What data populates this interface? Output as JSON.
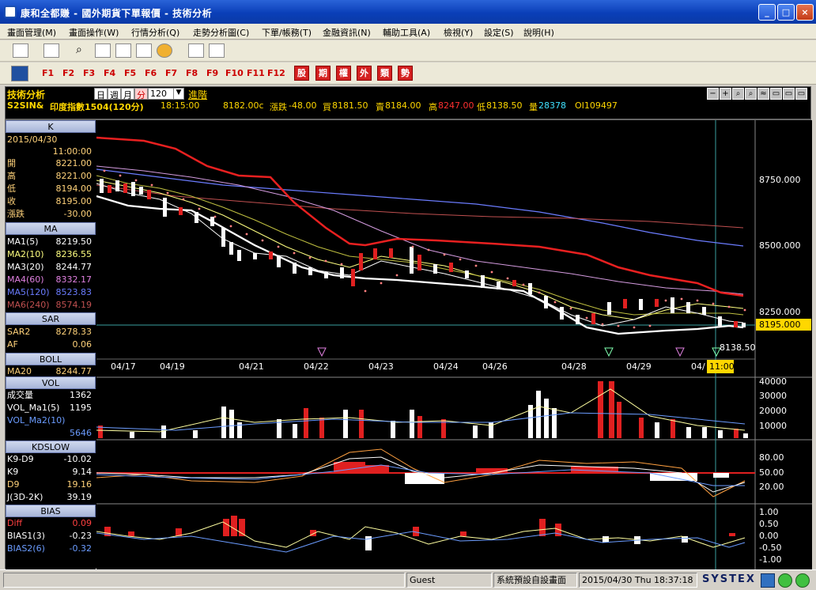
{
  "window": {
    "title": "康和全都賺 - 國外期貨下單報價 - 技術分析",
    "controls": [
      "_",
      "□",
      "×"
    ]
  },
  "menu": [
    "畫面管理(M)",
    "畫面操作(W)",
    "行情分析(Q)",
    "走勢分析圖(C)",
    "下單/帳務(T)",
    "金融資訊(N)",
    "輔助工具(A)",
    "檢視(Y)",
    "設定(S)",
    "說明(H)"
  ],
  "toolbar": {
    "fkeys": [
      "F1",
      "F2",
      "F3",
      "F4",
      "F5",
      "F6",
      "F7",
      "F8",
      "F9",
      "F10",
      "F11",
      "F12"
    ],
    "quick_buttons": [
      "股",
      "期",
      "權",
      "外",
      "類",
      "勢"
    ]
  },
  "chart_header": {
    "title": "技術分析",
    "periods": [
      "日",
      "週",
      "月",
      "分"
    ],
    "period_value": "120",
    "advanced_label": "進階",
    "symbol": "S2SIN&",
    "name": "印度指數1504(120分)",
    "time": "18:15:00",
    "last": "8182.00c",
    "change_label": "漲跌",
    "change": "-48.00",
    "bid_label": "買",
    "bid": "8181.50",
    "ask_label": "賣",
    "ask": "8184.00",
    "high_label": "高",
    "high": "8247.00",
    "low_label": "低",
    "low": "8138.50",
    "volume_label": "量",
    "volume": "28378",
    "oi": "OI109497",
    "chart_tools": [
      "−",
      "+",
      "⌕",
      "⌕",
      "≈",
      "▭",
      "▭",
      "▭"
    ]
  },
  "left_panel": {
    "k": {
      "head": "K",
      "date": "2015/04/30",
      "time": "11:00:00",
      "rows": [
        {
          "k": "開",
          "v": "8221.00"
        },
        {
          "k": "高",
          "v": "8221.00"
        },
        {
          "k": "低",
          "v": "8194.00"
        },
        {
          "k": "收",
          "v": "8195.00"
        },
        {
          "k": "漲跌",
          "v": "-30.00"
        }
      ]
    },
    "ma": {
      "head": "MA",
      "rows": [
        {
          "k": "MA1(5)",
          "v": "8219.50",
          "color": "#ffffff"
        },
        {
          "k": "MA2(10)",
          "v": "8236.55",
          "color": "#ffff80"
        },
        {
          "k": "MA3(20)",
          "v": "8244.77",
          "color": "#ffffff"
        },
        {
          "k": "MA4(60)",
          "v": "8332.17",
          "color": "#e080e0"
        },
        {
          "k": "MA5(120)",
          "v": "8523.83",
          "color": "#6b7cff"
        },
        {
          "k": "MA6(240)",
          "v": "8574.19",
          "color": "#c05050"
        }
      ]
    },
    "sar": {
      "head": "SAR",
      "rows": [
        {
          "k": "SAR2",
          "v": "8278.33"
        },
        {
          "k": "AF",
          "v": "0.06"
        }
      ]
    },
    "boll": {
      "head": "BOLL",
      "rows": [
        {
          "k": "MA20",
          "v": "8244.77"
        }
      ]
    },
    "vol": {
      "head": "VOL",
      "rows": [
        {
          "k": "成交量",
          "v": "1362",
          "color": "#ffffff"
        },
        {
          "k": "VOL_Ma1(5)",
          "v": "1195",
          "color": "#ffffff"
        },
        {
          "k": "VOL_Ma2(10)",
          "v": "",
          "color": "#6b9cff"
        },
        {
          "k": "",
          "v": "5646",
          "color": "#6b9cff"
        }
      ]
    },
    "kd": {
      "head": "KDSLOW",
      "rows": [
        {
          "k": "K9-D9",
          "v": "-10.02",
          "color": "#ffffff"
        },
        {
          "k": "K9",
          "v": "9.14",
          "color": "#ffffff"
        },
        {
          "k": "D9",
          "v": "19.16",
          "color": "#ffd27a"
        },
        {
          "k": "J(3D-2K)",
          "v": "39.19",
          "color": "#ffffff"
        }
      ]
    },
    "bias": {
      "head": "BIAS",
      "rows": [
        {
          "k": "Diff",
          "v": "0.09",
          "color": "#ff4040"
        },
        {
          "k": "BIAS1(3)",
          "v": "-0.23",
          "color": "#ffffff"
        },
        {
          "k": "BIAS2(6)",
          "v": "-0.32",
          "color": "#6b9cff"
        }
      ]
    }
  },
  "price_axis": {
    "ticks": [
      "8750.000",
      "8500.000",
      "8250.000"
    ],
    "current": "8195.000",
    "low_marker": "8138.50"
  },
  "date_axis": [
    "04/17",
    "04/19",
    "04/21",
    "04/22",
    "04/23",
    "04/24",
    "04/26",
    "04/28",
    "04/29",
    "04/",
    "11:00"
  ],
  "vol_axis": [
    "40000",
    "30000",
    "20000",
    "10000"
  ],
  "kd_axis": [
    "80.00",
    "50.00",
    "20.00"
  ],
  "bias_axis": [
    "1.00",
    "0.50",
    "0.00",
    "-0.50",
    "-1.00"
  ],
  "status": {
    "user": "Guest",
    "layout": "系統預設自設畫面",
    "datetime": "2015/04/30 Thu 18:37:18",
    "brand": "SYSTEX"
  }
}
